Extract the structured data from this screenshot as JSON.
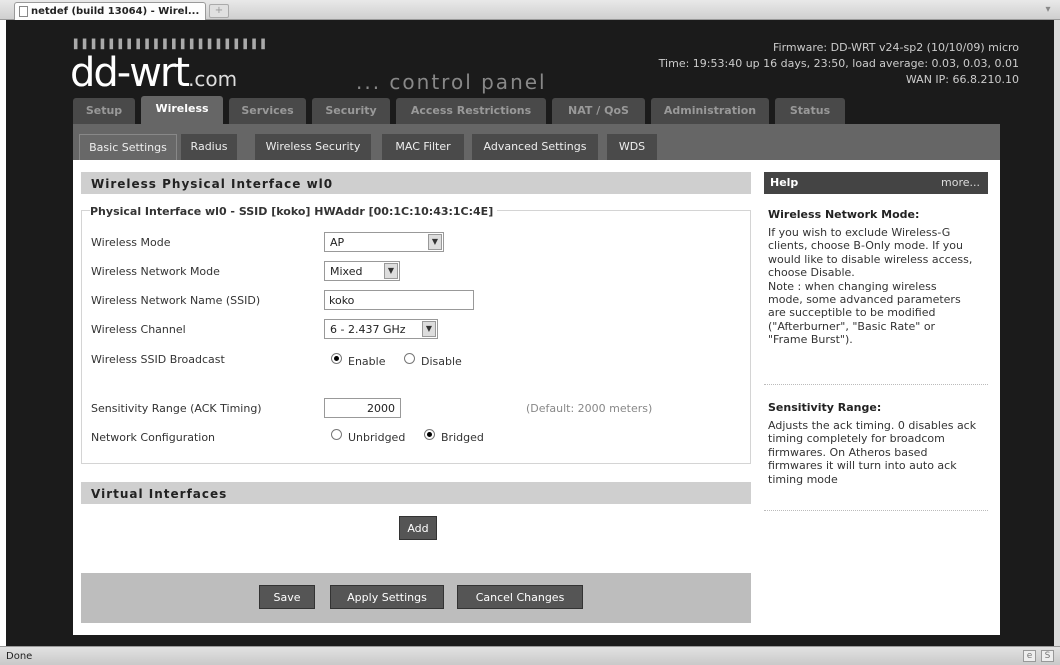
{
  "browser": {
    "tab_title": "netdef (build 13064) - Wirel...",
    "new_tab_symbol": "+",
    "status": "Done"
  },
  "header": {
    "logo_main": "dd-wrt",
    "logo_suffix": ".com",
    "subtitle": "... control panel",
    "firmware": "Firmware: DD-WRT v24-sp2 (10/10/09) micro",
    "time": "Time: 19:53:40 up 16 days, 23:50, load average: 0.03, 0.03, 0.01",
    "wan_ip": "WAN IP: 66.8.210.10"
  },
  "main_tabs": [
    "Setup",
    "Wireless",
    "Services",
    "Security",
    "Access Restrictions",
    "NAT / QoS",
    "Administration",
    "Status"
  ],
  "sub_tabs": [
    "Basic Settings",
    "Radius",
    "Wireless Security",
    "MAC Filter",
    "Advanced Settings",
    "WDS"
  ],
  "physical": {
    "heading": "Wireless Physical Interface wl0",
    "legend": "Physical Interface wl0 - SSID [koko] HWAddr [00:1C:10:43:1C:4E]",
    "fields": {
      "mode_label": "Wireless Mode",
      "mode_value": "AP",
      "net_mode_label": "Wireless Network Mode",
      "net_mode_value": "Mixed",
      "ssid_label": "Wireless Network Name (SSID)",
      "ssid_value": "koko",
      "channel_label": "Wireless Channel",
      "channel_value": "6 - 2.437 GHz",
      "broadcast_label": "Wireless SSID Broadcast",
      "broadcast_enable": "Enable",
      "broadcast_disable": "Disable",
      "sensitivity_label": "Sensitivity Range (ACK Timing)",
      "sensitivity_value": "2000",
      "sensitivity_default": "(Default: 2000 meters)",
      "netconf_label": "Network Configuration",
      "netconf_unbridged": "Unbridged",
      "netconf_bridged": "Bridged"
    }
  },
  "virtual": {
    "heading": "Virtual Interfaces",
    "add_label": "Add"
  },
  "actions": {
    "save": "Save",
    "apply": "Apply Settings",
    "cancel": "Cancel Changes"
  },
  "help": {
    "title": "Help",
    "more": "more...",
    "sections": [
      {
        "title": "Wireless Network Mode:",
        "lines": [
          "If you wish to exclude Wireless-G",
          "clients, choose B-Only mode. If you",
          "would like to disable wireless access,",
          "choose Disable.",
          "Note : when changing wireless",
          "mode, some advanced parameters",
          "are succeptible to be modified",
          "(\"Afterburner\", \"Basic Rate\" or",
          "\"Frame Burst\")."
        ]
      },
      {
        "title": "Sensitivity Range:",
        "lines": [
          "Adjusts the ack timing. 0 disables ack",
          "timing completely for broadcom",
          "firmwares. On Atheros based",
          "firmwares it will turn into auto ack",
          "timing mode"
        ]
      }
    ]
  }
}
